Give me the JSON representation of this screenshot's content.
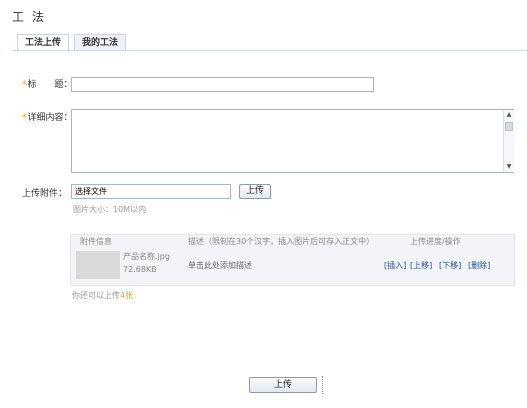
{
  "page": {
    "title": "工 法"
  },
  "tabs": [
    {
      "label": "工法上传"
    },
    {
      "label": "我的工法"
    }
  ],
  "form": {
    "required_mark": "*",
    "title_label": "标　　题：",
    "title_value": "",
    "detail_label": "详细内容：",
    "detail_value": "",
    "attachment_label": "上传附件：",
    "file_placeholder": "选择文件",
    "upload_button": "上传",
    "size_hint": "图片大小：10M以内"
  },
  "attachments": {
    "headers": {
      "info": "附件信息",
      "description": "描述（限制在30个汉字，插入图片后可存入正文中）",
      "progress": "上传进度/操作"
    },
    "rows": [
      {
        "filename": "产品名称.jpg",
        "size": "72.68KB",
        "description": "单击此处添加描述",
        "actions": [
          "[插入]",
          "[上移]",
          "[下移]",
          "[删除]"
        ]
      }
    ],
    "limit_prefix": "你还可以上传",
    "limit_count": "4",
    "limit_suffix": "张"
  },
  "footer": {
    "submit_label": "上传"
  }
}
